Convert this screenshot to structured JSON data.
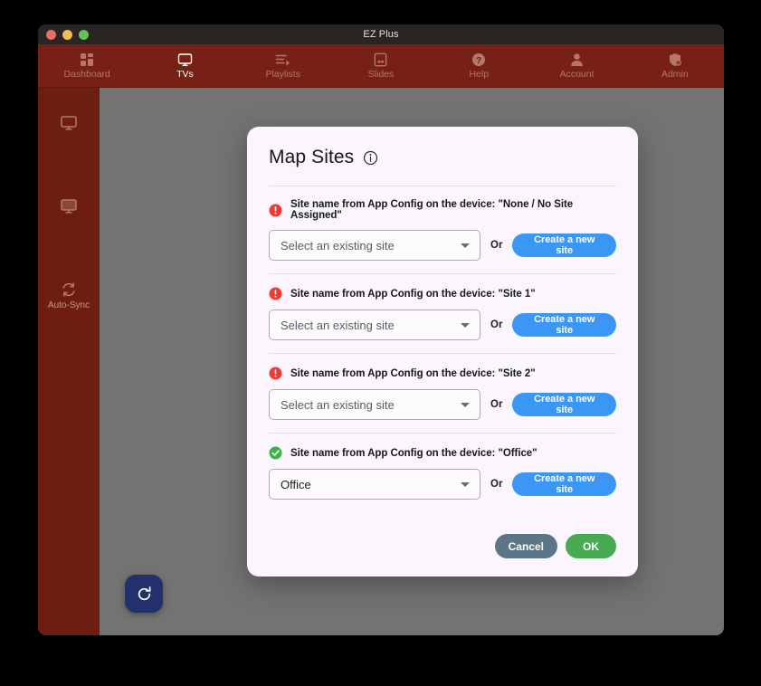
{
  "window": {
    "title": "EZ Plus",
    "traffic_lights": [
      "close",
      "minimize",
      "maximize"
    ]
  },
  "topnav": {
    "items": [
      {
        "label": "Dashboard",
        "icon": "dashboard-grid-icon",
        "active": false
      },
      {
        "label": "TVs",
        "icon": "monitor-icon",
        "active": true
      },
      {
        "label": "Playlists",
        "icon": "playlist-icon",
        "active": false
      },
      {
        "label": "Slides",
        "icon": "image-icon",
        "active": false
      },
      {
        "label": "Help",
        "icon": "question-circle-icon",
        "active": false
      },
      {
        "label": "Account",
        "icon": "person-icon",
        "active": false
      },
      {
        "label": "Admin",
        "icon": "shield-gear-icon",
        "active": false
      }
    ]
  },
  "sidebar": {
    "items": [
      {
        "label": "",
        "icon": "monitor-outline-icon"
      },
      {
        "label": "",
        "icon": "monitor-filled-icon"
      },
      {
        "label": "Auto-Sync",
        "icon": "sync-icon"
      }
    ]
  },
  "fab": {
    "icon": "refresh-icon",
    "label": "Refresh"
  },
  "modal": {
    "title": "Map Sites",
    "info_icon": "info-circle-icon",
    "rows": [
      {
        "status": "error",
        "status_icon": "error-exclamation-icon",
        "label": "Site name from App Config on the device: \"None / No Site Assigned\"",
        "select_value": "Select an existing site",
        "select_placeholder": "Select an existing site",
        "filled": false,
        "or_label": "Or",
        "create_label": "Create a new site"
      },
      {
        "status": "error",
        "status_icon": "error-exclamation-icon",
        "label": "Site name from App Config on the device: \"Site 1\"",
        "select_value": "Select an existing site",
        "select_placeholder": "Select an existing site",
        "filled": false,
        "or_label": "Or",
        "create_label": "Create a new site"
      },
      {
        "status": "error",
        "status_icon": "error-exclamation-icon",
        "label": "Site name from App Config on the device: \"Site 2\"",
        "select_value": "Select an existing site",
        "select_placeholder": "Select an existing site",
        "filled": false,
        "or_label": "Or",
        "create_label": "Create a new site"
      },
      {
        "status": "ok",
        "status_icon": "success-check-icon",
        "label": "Site name from App Config on the device: \"Office\"",
        "select_value": "Office",
        "select_placeholder": "Select an existing site",
        "filled": true,
        "or_label": "Or",
        "create_label": "Create a new site"
      }
    ],
    "footer": {
      "cancel_label": "Cancel",
      "ok_label": "OK"
    }
  },
  "colors": {
    "brand_red": "#762114",
    "sidebar_red": "#6e1e0f",
    "accent_blue": "#3b97f5",
    "ok_green": "#47ab52",
    "cancel_slate": "#5c7688",
    "error_red": "#ef3b33",
    "success_green": "#3ab54a",
    "modal_bg": "#fbf5fd",
    "backdrop_gray": "#737373",
    "fab_navy": "#23306b"
  }
}
